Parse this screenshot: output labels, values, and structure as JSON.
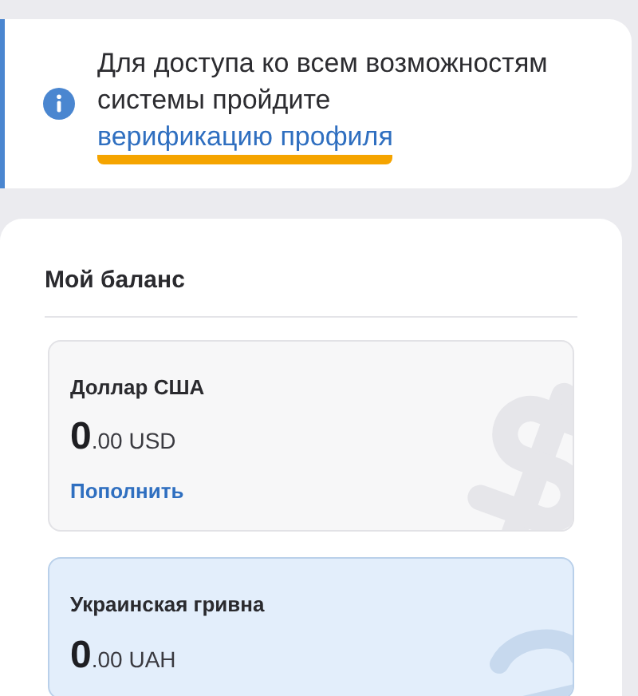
{
  "notice": {
    "text": "Для доступа ко всем возможностям системы пройдите ",
    "link": {
      "label": "верификацию профиля",
      "highlighted": true
    }
  },
  "balance": {
    "title": "Мой баланс",
    "accounts": [
      {
        "name": "Доллар США",
        "amount_whole": "0",
        "amount_rest": ".00 USD",
        "action": "Пополнить",
        "selected": false
      },
      {
        "name": "Украинская гривна",
        "amount_whole": "0",
        "amount_rest": ".00 UAH",
        "selected": true
      }
    ]
  }
}
